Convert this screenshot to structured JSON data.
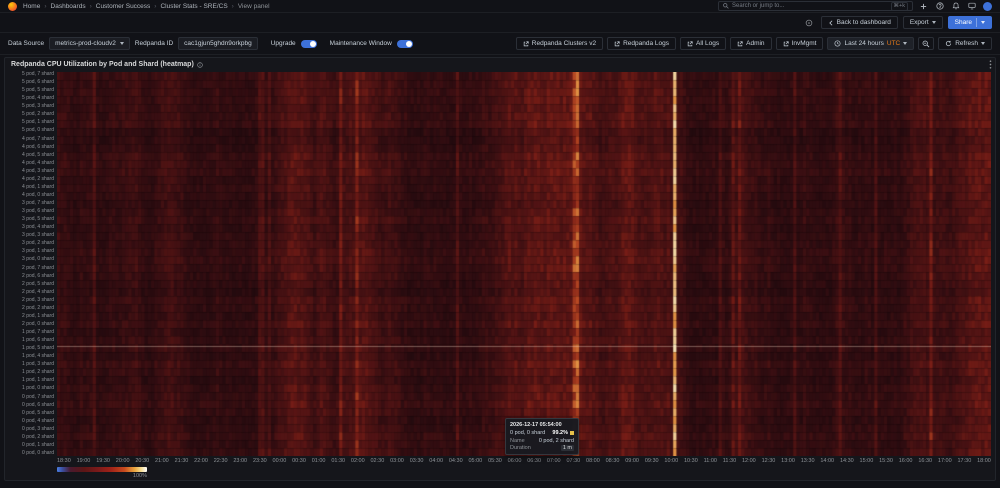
{
  "nav": {
    "breadcrumb": [
      "Home",
      "Dashboards",
      "Customer Success",
      "Cluster Stats - SRE/CS",
      "View panel"
    ],
    "search": {
      "placeholder": "Search or jump to...",
      "shortcut": "⌘+k"
    }
  },
  "toolbar": {
    "back_label": "Back to dashboard",
    "export_label": "Export",
    "share_label": "Share"
  },
  "controls": {
    "datasource_label": "Data Source",
    "datasource_value": "metrics-prod-cloudv2",
    "redpanda_id_label": "Redpanda ID",
    "redpanda_id_value": "cac1gjun5ghdn9orkpbg",
    "upgrade_label": "Upgrade",
    "maintenance_label": "Maintenance Window",
    "links": [
      "Redpanda Clusters v2",
      "Redpanda Logs",
      "All Logs",
      "Admin",
      "InvMgmt"
    ],
    "time_range": "Last 24 hours",
    "time_zone": "UTC",
    "refresh_label": "Refresh"
  },
  "panel": {
    "title": "Redpanda CPU Utilization by Pod and Shard (heatmap)"
  },
  "tooltip": {
    "timestamp": "2026-12-17 05:54:00",
    "series": "0 pod, 0 shard",
    "value": "99.2%",
    "name_label": "Name",
    "name_value": "0 pod, 2 shard",
    "duration_label": "Duration",
    "duration_value": "1 m"
  },
  "legend": {
    "max_label": "100%"
  },
  "colors": {
    "accent_blue": "#3d71d9",
    "utc_orange": "#eb7b18",
    "tooltip_swatch": "#e8c24a"
  },
  "chart_data": {
    "type": "heatmap",
    "title": "Redpanda CPU Utilization by Pod and Shard (heatmap)",
    "value_unit": "percent CPU utilization, 0-100%",
    "time_span": "Last 24 hours",
    "highlight_time": "2026-12-17 05:54:00",
    "highlight_value": "99.2%",
    "highlight_column_fraction": 0.661,
    "crosshair_row_fraction": 0.713,
    "x_labels": [
      "18:30",
      "19:00",
      "19:30",
      "20:00",
      "20:30",
      "21:00",
      "21:30",
      "22:00",
      "22:30",
      "23:00",
      "23:30",
      "00:00",
      "00:30",
      "01:00",
      "01:30",
      "02:00",
      "02:30",
      "03:00",
      "03:30",
      "04:00",
      "04:30",
      "05:00",
      "05:30",
      "06:00",
      "06:30",
      "07:00",
      "07:30",
      "08:00",
      "08:30",
      "09:00",
      "09:30",
      "10:00",
      "10:30",
      "11:00",
      "11:30",
      "12:00",
      "12:30",
      "13:00",
      "13:30",
      "14:00",
      "14:30",
      "15:00",
      "15:30",
      "16:00",
      "16:30",
      "17:00",
      "17:30",
      "18:00"
    ],
    "y_labels": [
      "5 pod, 7 shard",
      "5 pod, 6 shard",
      "5 pod, 5 shard",
      "5 pod, 4 shard",
      "5 pod, 3 shard",
      "5 pod, 2 shard",
      "5 pod, 1 shard",
      "5 pod, 0 shard",
      "4 pod, 7 shard",
      "4 pod, 6 shard",
      "4 pod, 5 shard",
      "4 pod, 4 shard",
      "4 pod, 3 shard",
      "4 pod, 2 shard",
      "4 pod, 1 shard",
      "4 pod, 0 shard",
      "3 pod, 7 shard",
      "3 pod, 6 shard",
      "3 pod, 5 shard",
      "3 pod, 4 shard",
      "3 pod, 3 shard",
      "3 pod, 2 shard",
      "3 pod, 1 shard",
      "3 pod, 0 shard",
      "2 pod, 7 shard",
      "2 pod, 6 shard",
      "2 pod, 5 shard",
      "2 pod, 4 shard",
      "2 pod, 3 shard",
      "2 pod, 2 shard",
      "2 pod, 1 shard",
      "2 pod, 0 shard",
      "1 pod, 7 shard",
      "1 pod, 6 shard",
      "1 pod, 5 shard",
      "1 pod, 4 shard",
      "1 pod, 3 shard",
      "1 pod, 2 shard",
      "1 pod, 1 shard",
      "1 pod, 0 shard",
      "0 pod, 7 shard",
      "0 pod, 6 shard",
      "0 pod, 5 shard",
      "0 pod, 4 shard",
      "0 pod, 3 shard",
      "0 pod, 2 shard",
      "0 pod, 1 shard",
      "0 pod, 0 shard"
    ],
    "legend": {
      "min": 0,
      "max_label": "100%"
    }
  }
}
